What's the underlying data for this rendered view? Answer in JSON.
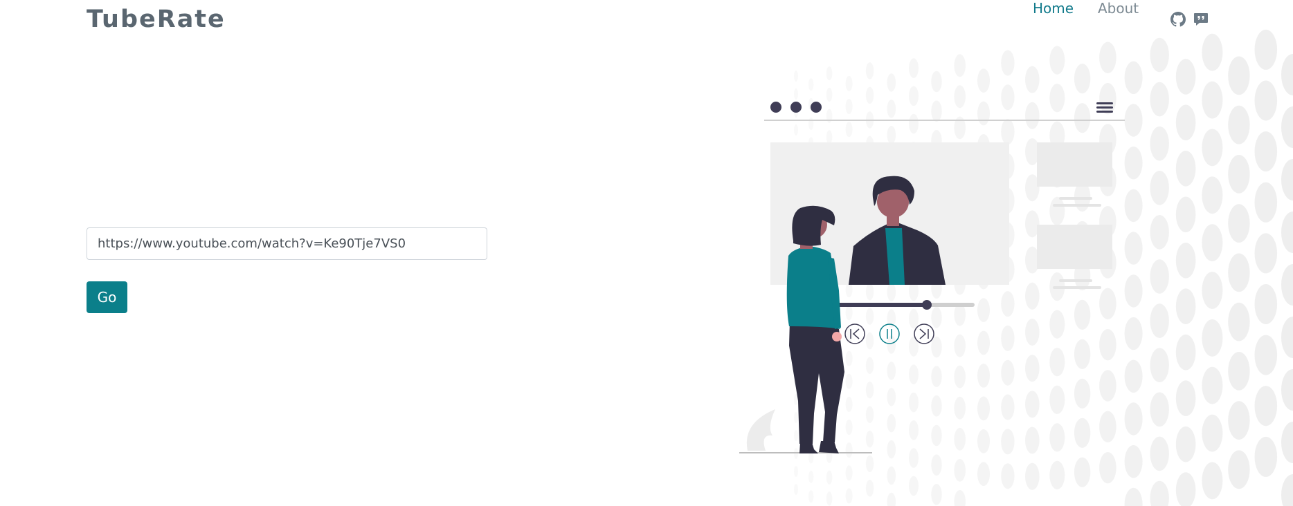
{
  "brand": {
    "name": "TubeRate"
  },
  "nav": {
    "items": [
      {
        "label": "Home",
        "active": true
      },
      {
        "label": "About",
        "active": false
      }
    ],
    "icons": [
      "github-icon",
      "chat-icon"
    ]
  },
  "form": {
    "url_value": "https://www.youtube.com/watch?v=Ke90Tje7VS0",
    "submit_label": "Go"
  },
  "colors": {
    "accent": "#0b7f8a",
    "nav_active": "#117a8b",
    "brand_text": "#5a6670",
    "illustration_dark": "#2f2e41",
    "illustration_teal": "#0b7f8a",
    "illustration_skin": "#a0616a"
  }
}
